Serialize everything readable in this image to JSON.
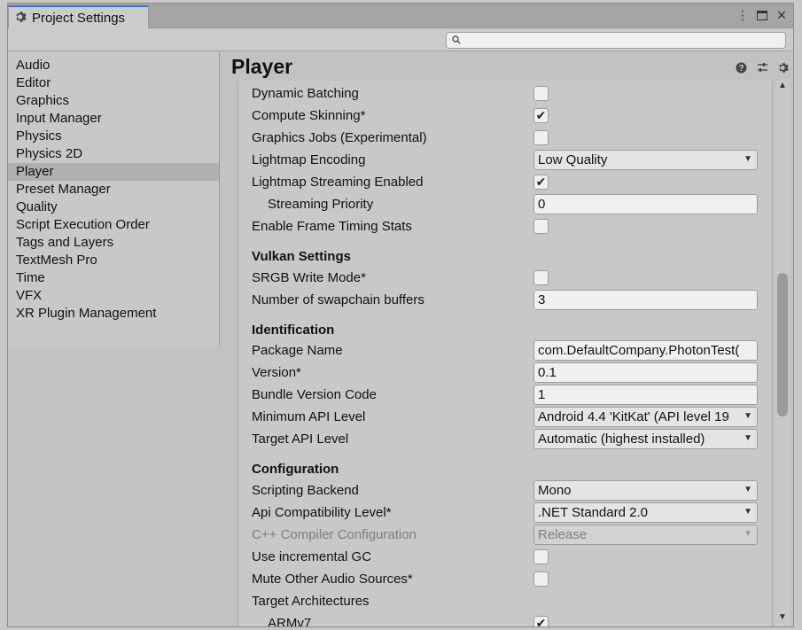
{
  "window": {
    "tab_title": "Project Settings",
    "search_placeholder": ""
  },
  "sidebar": {
    "items": [
      {
        "label": "Audio"
      },
      {
        "label": "Editor"
      },
      {
        "label": "Graphics"
      },
      {
        "label": "Input Manager"
      },
      {
        "label": "Physics"
      },
      {
        "label": "Physics 2D"
      },
      {
        "label": "Player",
        "selected": true
      },
      {
        "label": "Preset Manager"
      },
      {
        "label": "Quality"
      },
      {
        "label": "Script Execution Order"
      },
      {
        "label": "Tags and Layers"
      },
      {
        "label": "TextMesh Pro"
      },
      {
        "label": "Time"
      },
      {
        "label": "VFX"
      },
      {
        "label": "XR Plugin Management"
      }
    ]
  },
  "main": {
    "title": "Player",
    "header_icons": [
      "help-icon",
      "presets-icon",
      "gear-icon"
    ]
  },
  "settings": {
    "dynamic_batching": {
      "label": "Dynamic Batching",
      "checked": false
    },
    "compute_skinning": {
      "label": "Compute Skinning*",
      "checked": true
    },
    "graphics_jobs": {
      "label": "Graphics Jobs (Experimental)",
      "checked": false
    },
    "lightmap_encoding": {
      "label": "Lightmap Encoding",
      "value": "Low Quality"
    },
    "lightmap_streaming": {
      "label": "Lightmap Streaming Enabled",
      "checked": true
    },
    "streaming_priority": {
      "label": "Streaming Priority",
      "value": "0"
    },
    "frame_timing": {
      "label": "Enable Frame Timing Stats",
      "checked": false
    },
    "vulkan_title": "Vulkan Settings",
    "srgb_write": {
      "label": "SRGB Write Mode*",
      "checked": false
    },
    "swapchain": {
      "label": "Number of swapchain buffers",
      "value": "3"
    },
    "identification_title": "Identification",
    "package_name": {
      "label": "Package Name",
      "value": "com.DefaultCompany.PhotonTest("
    },
    "version": {
      "label": "Version*",
      "value": "0.1"
    },
    "bundle_version": {
      "label": "Bundle Version Code",
      "value": "1"
    },
    "min_api": {
      "label": "Minimum API Level",
      "value": "Android 4.4 'KitKat' (API level 19"
    },
    "target_api": {
      "label": "Target API Level",
      "value": "Automatic (highest installed)"
    },
    "configuration_title": "Configuration",
    "scripting_backend": {
      "label": "Scripting Backend",
      "value": "Mono"
    },
    "api_compat": {
      "label": "Api Compatibility Level*",
      "value": ".NET Standard 2.0"
    },
    "cpp_config": {
      "label": "C++ Compiler Configuration",
      "value": "Release"
    },
    "incremental_gc": {
      "label": "Use incremental GC",
      "checked": false
    },
    "mute_audio": {
      "label": "Mute Other Audio Sources*",
      "checked": false
    },
    "target_arch": {
      "label": "Target Architectures"
    },
    "armv7": {
      "label": "ARMv7",
      "checked": true
    }
  }
}
